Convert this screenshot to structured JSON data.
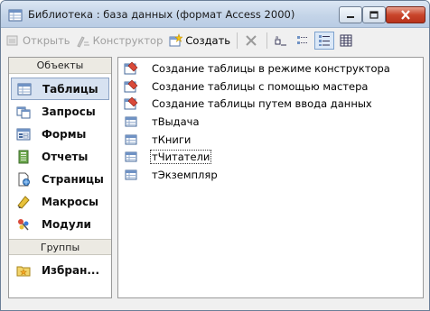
{
  "window": {
    "title": "Библиотека : база данных (формат Access 2000)",
    "icon": "access-db-icon"
  },
  "toolbar": {
    "open_label": "Открыть",
    "designer_label": "Конструктор",
    "create_label": "Создать",
    "open_icon": "open-icon",
    "designer_icon": "design-icon",
    "create_icon": "new-object-icon",
    "view_buttons": [
      "delete",
      "large-icons",
      "small-icons",
      "list",
      "details"
    ]
  },
  "sidebar": {
    "objects_header": "Объекты",
    "groups_header": "Группы",
    "items": [
      {
        "label": "Таблицы",
        "icon": "table-icon",
        "active": true
      },
      {
        "label": "Запросы",
        "icon": "query-icon"
      },
      {
        "label": "Формы",
        "icon": "form-icon"
      },
      {
        "label": "Отчеты",
        "icon": "report-icon"
      },
      {
        "label": "Страницы",
        "icon": "page-icon"
      },
      {
        "label": "Макросы",
        "icon": "macro-icon"
      },
      {
        "label": "Модули",
        "icon": "module-icon"
      }
    ],
    "groups": [
      {
        "label": "Избран...",
        "icon": "favorites-icon"
      }
    ]
  },
  "list": {
    "items": [
      {
        "label": "Создание таблицы в режиме конструктора",
        "icon": "create-wizard-icon"
      },
      {
        "label": "Создание таблицы с помощью мастера",
        "icon": "create-wizard-icon"
      },
      {
        "label": "Создание таблицы путем ввода данных",
        "icon": "create-wizard-icon"
      },
      {
        "label": "тВыдача",
        "icon": "table-icon"
      },
      {
        "label": "тКниги",
        "icon": "table-icon"
      },
      {
        "label": "тЧитатели",
        "icon": "table-icon",
        "selected": true
      },
      {
        "label": "тЭкземпляр",
        "icon": "table-icon"
      }
    ]
  },
  "colors": {
    "title_gradient_top": "#dbe6f3",
    "close_button": "#c9452b",
    "selection_bg": "#d7e2f1"
  }
}
